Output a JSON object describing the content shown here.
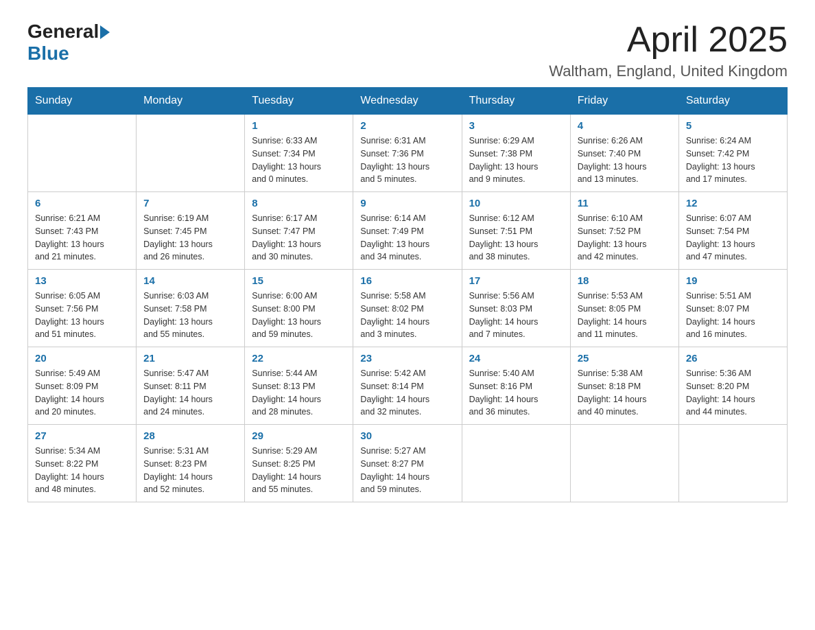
{
  "logo": {
    "general": "General",
    "blue": "Blue"
  },
  "title": "April 2025",
  "subtitle": "Waltham, England, United Kingdom",
  "headers": [
    "Sunday",
    "Monday",
    "Tuesday",
    "Wednesday",
    "Thursday",
    "Friday",
    "Saturday"
  ],
  "weeks": [
    [
      {
        "day": "",
        "info": ""
      },
      {
        "day": "",
        "info": ""
      },
      {
        "day": "1",
        "info": "Sunrise: 6:33 AM\nSunset: 7:34 PM\nDaylight: 13 hours\nand 0 minutes."
      },
      {
        "day": "2",
        "info": "Sunrise: 6:31 AM\nSunset: 7:36 PM\nDaylight: 13 hours\nand 5 minutes."
      },
      {
        "day": "3",
        "info": "Sunrise: 6:29 AM\nSunset: 7:38 PM\nDaylight: 13 hours\nand 9 minutes."
      },
      {
        "day": "4",
        "info": "Sunrise: 6:26 AM\nSunset: 7:40 PM\nDaylight: 13 hours\nand 13 minutes."
      },
      {
        "day": "5",
        "info": "Sunrise: 6:24 AM\nSunset: 7:42 PM\nDaylight: 13 hours\nand 17 minutes."
      }
    ],
    [
      {
        "day": "6",
        "info": "Sunrise: 6:21 AM\nSunset: 7:43 PM\nDaylight: 13 hours\nand 21 minutes."
      },
      {
        "day": "7",
        "info": "Sunrise: 6:19 AM\nSunset: 7:45 PM\nDaylight: 13 hours\nand 26 minutes."
      },
      {
        "day": "8",
        "info": "Sunrise: 6:17 AM\nSunset: 7:47 PM\nDaylight: 13 hours\nand 30 minutes."
      },
      {
        "day": "9",
        "info": "Sunrise: 6:14 AM\nSunset: 7:49 PM\nDaylight: 13 hours\nand 34 minutes."
      },
      {
        "day": "10",
        "info": "Sunrise: 6:12 AM\nSunset: 7:51 PM\nDaylight: 13 hours\nand 38 minutes."
      },
      {
        "day": "11",
        "info": "Sunrise: 6:10 AM\nSunset: 7:52 PM\nDaylight: 13 hours\nand 42 minutes."
      },
      {
        "day": "12",
        "info": "Sunrise: 6:07 AM\nSunset: 7:54 PM\nDaylight: 13 hours\nand 47 minutes."
      }
    ],
    [
      {
        "day": "13",
        "info": "Sunrise: 6:05 AM\nSunset: 7:56 PM\nDaylight: 13 hours\nand 51 minutes."
      },
      {
        "day": "14",
        "info": "Sunrise: 6:03 AM\nSunset: 7:58 PM\nDaylight: 13 hours\nand 55 minutes."
      },
      {
        "day": "15",
        "info": "Sunrise: 6:00 AM\nSunset: 8:00 PM\nDaylight: 13 hours\nand 59 minutes."
      },
      {
        "day": "16",
        "info": "Sunrise: 5:58 AM\nSunset: 8:02 PM\nDaylight: 14 hours\nand 3 minutes."
      },
      {
        "day": "17",
        "info": "Sunrise: 5:56 AM\nSunset: 8:03 PM\nDaylight: 14 hours\nand 7 minutes."
      },
      {
        "day": "18",
        "info": "Sunrise: 5:53 AM\nSunset: 8:05 PM\nDaylight: 14 hours\nand 11 minutes."
      },
      {
        "day": "19",
        "info": "Sunrise: 5:51 AM\nSunset: 8:07 PM\nDaylight: 14 hours\nand 16 minutes."
      }
    ],
    [
      {
        "day": "20",
        "info": "Sunrise: 5:49 AM\nSunset: 8:09 PM\nDaylight: 14 hours\nand 20 minutes."
      },
      {
        "day": "21",
        "info": "Sunrise: 5:47 AM\nSunset: 8:11 PM\nDaylight: 14 hours\nand 24 minutes."
      },
      {
        "day": "22",
        "info": "Sunrise: 5:44 AM\nSunset: 8:13 PM\nDaylight: 14 hours\nand 28 minutes."
      },
      {
        "day": "23",
        "info": "Sunrise: 5:42 AM\nSunset: 8:14 PM\nDaylight: 14 hours\nand 32 minutes."
      },
      {
        "day": "24",
        "info": "Sunrise: 5:40 AM\nSunset: 8:16 PM\nDaylight: 14 hours\nand 36 minutes."
      },
      {
        "day": "25",
        "info": "Sunrise: 5:38 AM\nSunset: 8:18 PM\nDaylight: 14 hours\nand 40 minutes."
      },
      {
        "day": "26",
        "info": "Sunrise: 5:36 AM\nSunset: 8:20 PM\nDaylight: 14 hours\nand 44 minutes."
      }
    ],
    [
      {
        "day": "27",
        "info": "Sunrise: 5:34 AM\nSunset: 8:22 PM\nDaylight: 14 hours\nand 48 minutes."
      },
      {
        "day": "28",
        "info": "Sunrise: 5:31 AM\nSunset: 8:23 PM\nDaylight: 14 hours\nand 52 minutes."
      },
      {
        "day": "29",
        "info": "Sunrise: 5:29 AM\nSunset: 8:25 PM\nDaylight: 14 hours\nand 55 minutes."
      },
      {
        "day": "30",
        "info": "Sunrise: 5:27 AM\nSunset: 8:27 PM\nDaylight: 14 hours\nand 59 minutes."
      },
      {
        "day": "",
        "info": ""
      },
      {
        "day": "",
        "info": ""
      },
      {
        "day": "",
        "info": ""
      }
    ]
  ]
}
